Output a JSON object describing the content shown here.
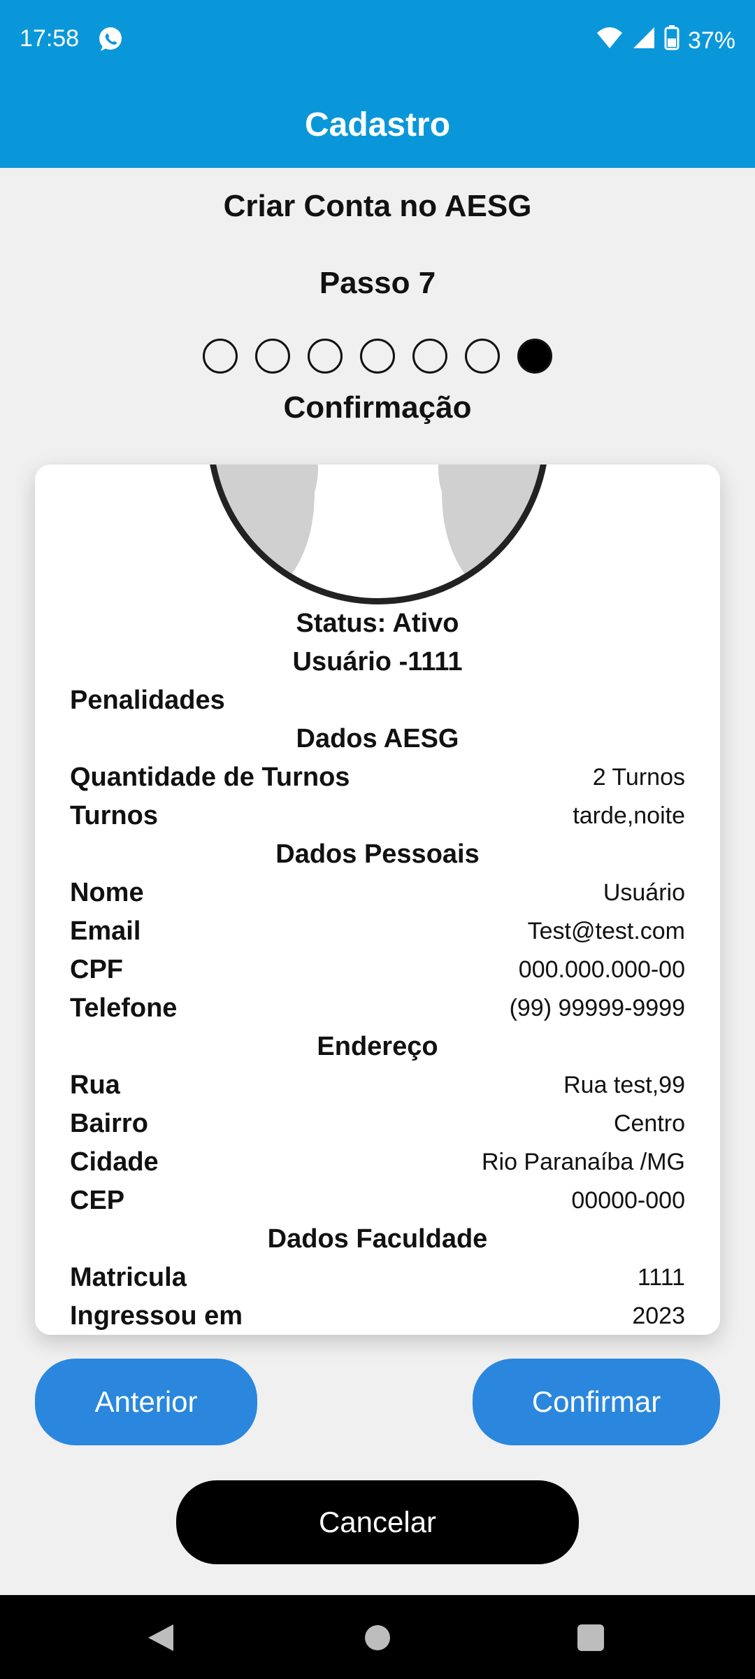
{
  "status_bar": {
    "time": "17:58",
    "battery": "37%",
    "icons": [
      "whatsapp-icon",
      "wifi-icon",
      "signal-icon",
      "battery-icon"
    ]
  },
  "app_bar": {
    "title": "Cadastro"
  },
  "header": {
    "title": "Criar Conta no AESG",
    "step": "Passo 7",
    "subtitle": "Confirmação",
    "progress": {
      "total": 7,
      "current": 7
    }
  },
  "profile": {
    "status": "Status: Ativo",
    "user": "Usuário -1111",
    "penalties_label": "Penalidades"
  },
  "sections": {
    "aesg": {
      "title": "Dados AESG",
      "shifts_count_label": "Quantidade de Turnos",
      "shifts_count_value": "2 Turnos",
      "shifts_label": "Turnos",
      "shifts_value": "tarde,noite"
    },
    "personal": {
      "title": "Dados Pessoais",
      "name_label": "Nome",
      "name_value": "Usuário",
      "email_label": "Email",
      "email_value": "Test@test.com",
      "cpf_label": "CPF",
      "cpf_value": "000.000.000-00",
      "phone_label": "Telefone",
      "phone_value": "(99) 99999-9999"
    },
    "address": {
      "title": "Endereço",
      "street_label": "Rua",
      "street_value": "Rua test,99",
      "district_label": "Bairro",
      "district_value": "Centro",
      "city_label": "Cidade",
      "city_value": "Rio Paranaíba /MG",
      "cep_label": "CEP",
      "cep_value": "00000-000"
    },
    "college": {
      "title": "Dados Faculdade",
      "enrollment_label": "Matricula",
      "enrollment_value": "1111",
      "joined_label": "Ingressou em",
      "joined_value": "2023"
    }
  },
  "buttons": {
    "previous": "Anterior",
    "confirm": "Confirmar",
    "cancel": "Cancelar"
  },
  "colors": {
    "app_bar": "#0a97d9",
    "button_primary": "#2a87dd",
    "button_cancel": "#000000",
    "background": "#f0f0f0"
  }
}
